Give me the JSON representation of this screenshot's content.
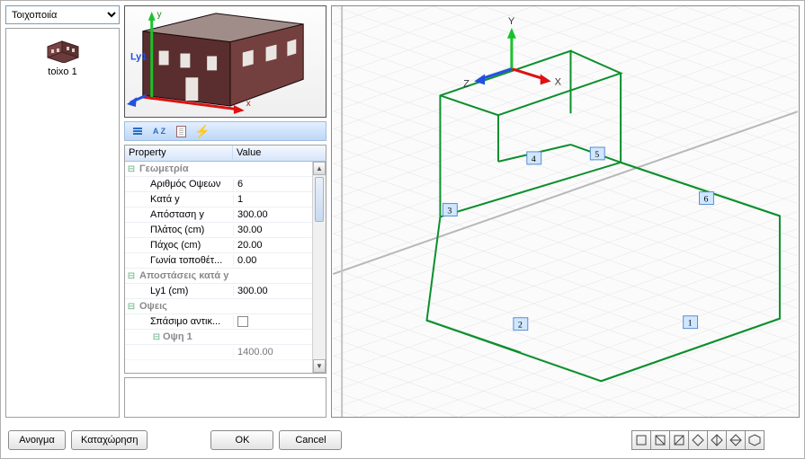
{
  "dropdown": {
    "selected": "Τοιχοποιία"
  },
  "item": {
    "label": "toixo 1"
  },
  "preview": {
    "ly_label": "Ly1"
  },
  "toolbar": {
    "az_text": "A\nZ"
  },
  "grid": {
    "head_property": "Property",
    "head_value": "Value",
    "groups": [
      {
        "label": "Γεωμετρία",
        "rows": [
          {
            "name": "Αριθμός Οψεων",
            "value": "6"
          },
          {
            "name": "Κατά y",
            "value": "1"
          },
          {
            "name": "Απόσταση y",
            "value": "300.00"
          },
          {
            "name": "Πλάτος (cm)",
            "value": "30.00"
          },
          {
            "name": "Πάχος (cm)",
            "value": "20.00"
          },
          {
            "name": "Γωνία τοποθέτ...",
            "value": "0.00"
          }
        ]
      },
      {
        "label": "Αποστάσεις κατά y",
        "rows": [
          {
            "name": "Ly1 (cm)",
            "value": "300.00"
          }
        ]
      },
      {
        "label": "Οψεις",
        "rows": [
          {
            "name": "Σπάσιμο αντικ...",
            "value": "",
            "checkbox": true
          }
        ],
        "subgroups": [
          {
            "label": "Οψη 1",
            "rows": [
              {
                "name": "",
                "value": "1400.00"
              }
            ]
          }
        ]
      }
    ]
  },
  "viewport": {
    "axis_x": "X",
    "axis_y": "Y",
    "axis_z": "Z",
    "node_labels": [
      "1",
      "2",
      "3",
      "4",
      "5",
      "6"
    ]
  },
  "buttons": {
    "open": "Ανοιγμα",
    "register": "Καταχώρηση",
    "ok": "OK",
    "cancel": "Cancel"
  }
}
